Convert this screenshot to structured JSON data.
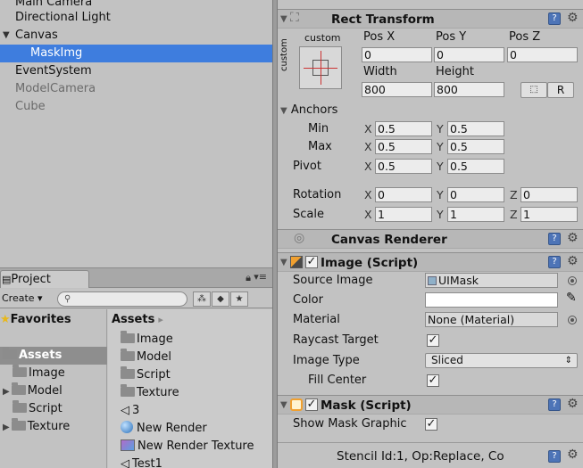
{
  "hierarchy": {
    "items": [
      {
        "label": "Main Camera"
      },
      {
        "label": "Directional Light"
      },
      {
        "label": "Canvas"
      },
      {
        "label": "MaskImg"
      },
      {
        "label": "EventSystem"
      },
      {
        "label": "ModelCamera"
      },
      {
        "label": "Cube"
      }
    ]
  },
  "project": {
    "tab_label": "Project",
    "create_label": "Create",
    "search_placeholder": "",
    "favorites_label": "Favorites",
    "tree": {
      "assets_label": "Assets",
      "children": [
        "Image",
        "Model",
        "Script",
        "Texture"
      ]
    },
    "assets_header": "Assets",
    "assets": [
      "Image",
      "Model",
      "Script",
      "Texture",
      "3",
      "New Render",
      "New Render Texture",
      "Test1"
    ]
  },
  "inspector": {
    "rect_transform": {
      "title": "Rect Transform",
      "anchor_preset": "custom",
      "anchor_preset_side": "custom",
      "pos_x_label": "Pos X",
      "pos_y_label": "Pos Y",
      "pos_z_label": "Pos Z",
      "pos_x": "0",
      "pos_y": "0",
      "pos_z": "0",
      "width_label": "Width",
      "height_label": "Height",
      "width": "800",
      "height": "800",
      "r_button": "R",
      "anchors_label": "Anchors",
      "min_label": "Min",
      "max_label": "Max",
      "pivot_label": "Pivot",
      "min_x": "0.5",
      "min_y": "0.5",
      "max_x": "0.5",
      "max_y": "0.5",
      "pivot_x": "0.5",
      "pivot_y": "0.5",
      "rotation_label": "Rotation",
      "rot_x": "0",
      "rot_y": "0",
      "rot_z": "0",
      "scale_label": "Scale",
      "scale_x": "1",
      "scale_y": "1",
      "scale_z": "1",
      "x_axis": "X",
      "y_axis": "Y",
      "z_axis": "Z"
    },
    "canvas_renderer": {
      "title": "Canvas Renderer"
    },
    "image": {
      "title": "Image (Script)",
      "source_image_label": "Source Image",
      "source_image_value": "UIMask",
      "color_label": "Color",
      "material_label": "Material",
      "material_value": "None (Material)",
      "raycast_label": "Raycast Target",
      "raycast_checked": true,
      "image_type_label": "Image Type",
      "image_type_value": "Sliced",
      "fill_center_label": "Fill Center",
      "fill_center_checked": true
    },
    "mask": {
      "title": "Mask (Script)",
      "show_graphic_label": "Show Mask Graphic",
      "show_graphic_checked": true
    },
    "stencil_text": "Stencil Id:1, Op:Replace, Co"
  },
  "colors": {
    "selection": "#3e7dde",
    "panel_bg": "#c2c2c2",
    "help_icon": "#4d74b7"
  }
}
